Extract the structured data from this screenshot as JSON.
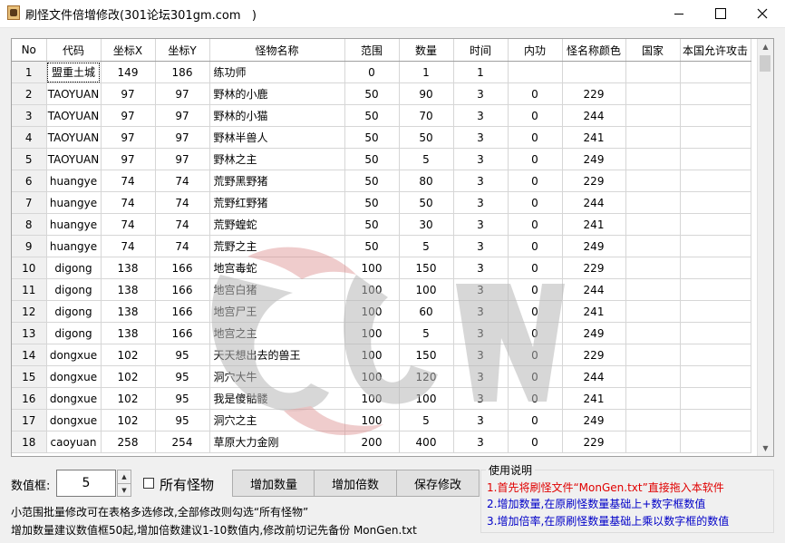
{
  "window": {
    "title": "刷怪文件倍增修改(301论坛301gm.com   )",
    "minimize_icon": "minimize-icon",
    "maximize_icon": "maximize-icon",
    "close_icon": "close-icon"
  },
  "grid": {
    "columns": [
      "No",
      "代码",
      "坐标X",
      "坐标Y",
      "怪物名称",
      "范围",
      "数量",
      "时间",
      "内功",
      "怪名称颜色",
      "国家",
      "本国允许攻击"
    ],
    "rows": [
      [
        "1",
        "盟重土城",
        "149",
        "186",
        "练功师",
        "0",
        "1",
        "1",
        "",
        "",
        "",
        ""
      ],
      [
        "2",
        "TAOYUAN",
        "97",
        "97",
        "野林的小鹿",
        "50",
        "90",
        "3",
        "0",
        "229",
        "",
        ""
      ],
      [
        "3",
        "TAOYUAN",
        "97",
        "97",
        "野林的小猫",
        "50",
        "70",
        "3",
        "0",
        "244",
        "",
        ""
      ],
      [
        "4",
        "TAOYUAN",
        "97",
        "97",
        "野林半兽人",
        "50",
        "50",
        "3",
        "0",
        "241",
        "",
        ""
      ],
      [
        "5",
        "TAOYUAN",
        "97",
        "97",
        "野林之主",
        "50",
        "5",
        "3",
        "0",
        "249",
        "",
        ""
      ],
      [
        "6",
        "huangye",
        "74",
        "74",
        "荒野黑野猪",
        "50",
        "80",
        "3",
        "0",
        "229",
        "",
        ""
      ],
      [
        "7",
        "huangye",
        "74",
        "74",
        "荒野红野猪",
        "50",
        "50",
        "3",
        "0",
        "244",
        "",
        ""
      ],
      [
        "8",
        "huangye",
        "74",
        "74",
        "荒野蝗蛇",
        "50",
        "30",
        "3",
        "0",
        "241",
        "",
        ""
      ],
      [
        "9",
        "huangye",
        "74",
        "74",
        "荒野之主",
        "50",
        "5",
        "3",
        "0",
        "249",
        "",
        ""
      ],
      [
        "10",
        "digong",
        "138",
        "166",
        "地宫毒蛇",
        "100",
        "150",
        "3",
        "0",
        "229",
        "",
        ""
      ],
      [
        "11",
        "digong",
        "138",
        "166",
        "地宫白猪",
        "100",
        "100",
        "3",
        "0",
        "244",
        "",
        ""
      ],
      [
        "12",
        "digong",
        "138",
        "166",
        "地宫尸王",
        "100",
        "60",
        "3",
        "0",
        "241",
        "",
        ""
      ],
      [
        "13",
        "digong",
        "138",
        "166",
        "地宫之主",
        "100",
        "5",
        "3",
        "0",
        "249",
        "",
        ""
      ],
      [
        "14",
        "dongxue",
        "102",
        "95",
        "天天想出去的兽王",
        "100",
        "150",
        "3",
        "0",
        "229",
        "",
        ""
      ],
      [
        "15",
        "dongxue",
        "102",
        "95",
        "洞穴大牛",
        "100",
        "120",
        "3",
        "0",
        "244",
        "",
        ""
      ],
      [
        "16",
        "dongxue",
        "102",
        "95",
        "我是傻骷髅",
        "100",
        "100",
        "3",
        "0",
        "241",
        "",
        ""
      ],
      [
        "17",
        "dongxue",
        "102",
        "95",
        "洞穴之主",
        "100",
        "5",
        "3",
        "0",
        "249",
        "",
        ""
      ],
      [
        "18",
        "caoyuan",
        "258",
        "254",
        "草原大力金刚",
        "200",
        "400",
        "3",
        "0",
        "229",
        "",
        ""
      ]
    ]
  },
  "controls": {
    "num_label": "数值框:",
    "num_value": "5",
    "all_monsters_label": "所有怪物",
    "btn_add_count": "增加数量",
    "btn_add_multiple": "增加倍数",
    "btn_save": "保存修改",
    "hint1": "小范围批量修改可在表格多选修改,全部修改则勾选“所有怪物”",
    "hint2": "增加数量建议数值框50起,增加倍数建议1-10数值内,修改前切记先备份 MonGen.txt"
  },
  "usage": {
    "title": "使用说明",
    "line1": "1.首先将刷怪文件“MonGen.txt”直接拖入本软件",
    "line2": "2.增加数量,在原刷怪数量基础上+数字框数值",
    "line3": "3.增加倍率,在原刷怪数量基础上乘以数字框的数值"
  },
  "colors": {
    "usage_red": "#e00000",
    "usage_blue": "#0000c8"
  }
}
